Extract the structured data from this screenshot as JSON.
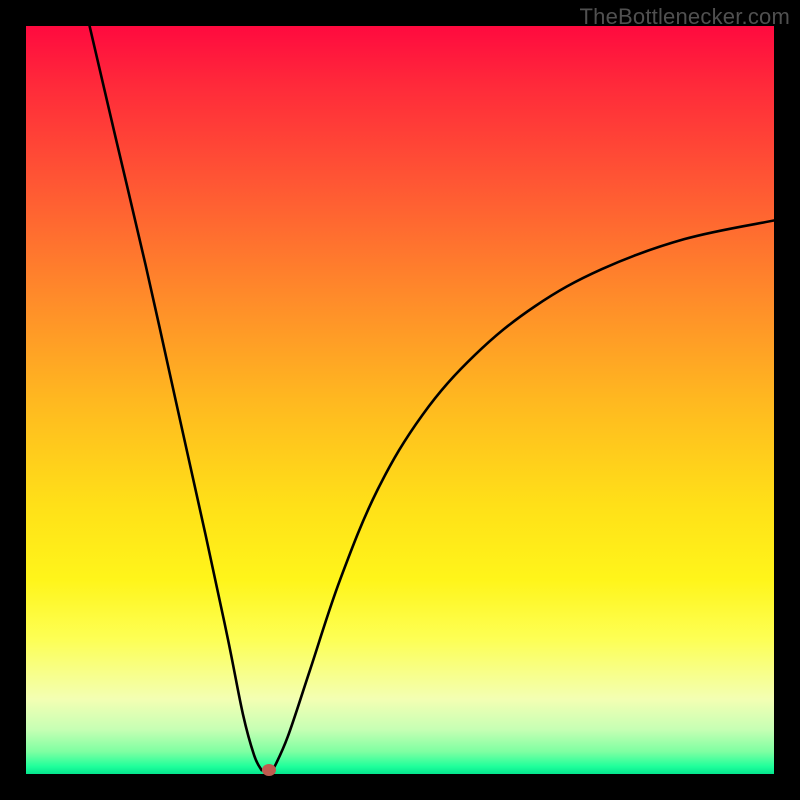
{
  "watermark": "TheBottlenecker.com",
  "colors": {
    "frame": "#000000",
    "curve_stroke": "#000000",
    "dot_fill": "#c05a4f",
    "gradient_top": "#ff0a3f",
    "gradient_bottom": "#04e58e"
  },
  "chart_data": {
    "type": "line",
    "title": "",
    "xlabel": "",
    "ylabel": "",
    "xlim": [
      0,
      100
    ],
    "ylim": [
      0,
      100
    ],
    "grid": false,
    "legend": false,
    "series": [
      {
        "name": "left_branch",
        "x": [
          8.5,
          12,
          16,
          20,
          24,
          27,
          29,
          30.5,
          31.5
        ],
        "values": [
          100,
          85,
          68,
          50,
          32,
          18,
          8,
          2.5,
          0.5
        ]
      },
      {
        "name": "right_branch",
        "x": [
          33,
          35,
          38,
          42,
          47,
          53,
          60,
          68,
          77,
          88,
          100
        ],
        "values": [
          0.5,
          5,
          14,
          26,
          38,
          48,
          56,
          62.5,
          67.5,
          71.5,
          74
        ]
      }
    ],
    "annotations": [
      {
        "name": "minimum",
        "x": 32.5,
        "y": 0.5
      }
    ]
  }
}
